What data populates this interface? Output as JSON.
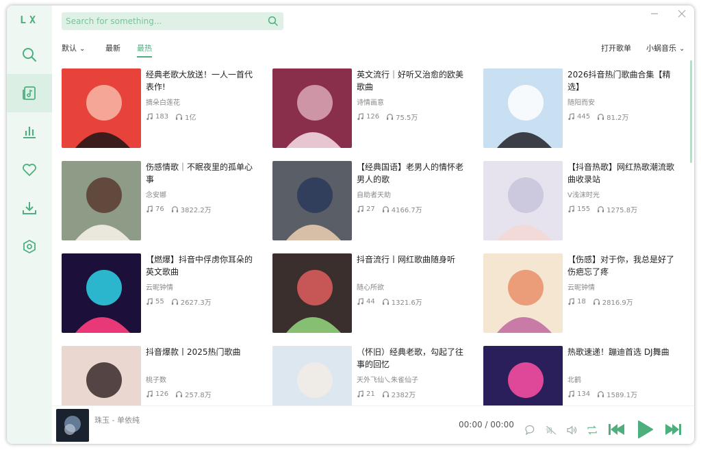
{
  "app": {
    "logo": "LX"
  },
  "search": {
    "placeholder": "Search for something..."
  },
  "filters": {
    "sort": "默认",
    "latest": "最新",
    "hottest": "最热"
  },
  "actions": {
    "open_playlist": "打开歌单",
    "source": "小蜗音乐"
  },
  "colors": {
    "accent": "#4caf7d",
    "sidebar_bg": "#eef7f2",
    "search_bg": "#dff0e6"
  },
  "sidebar_icons": [
    "search-icon",
    "music-list-icon",
    "chart-icon",
    "heart-icon",
    "download-icon",
    "settings-icon"
  ],
  "playlists": [
    {
      "title": "经典老歌大放送！一人一首代表作!",
      "author": "摘朵白莲花",
      "songs": "183",
      "plays": "1亿"
    },
    {
      "title": "英文流行｜好听又治愈的欧美歌曲",
      "author": "诗情画意",
      "songs": "126",
      "plays": "75.5万"
    },
    {
      "title": "2026抖音热门歌曲合集【精选】",
      "author": "随阳而安",
      "songs": "445",
      "plays": "81.2万"
    },
    {
      "title": "伤感情歌｜不眠夜里的孤单心事",
      "author": "念安娜",
      "songs": "76",
      "plays": "3822.2万"
    },
    {
      "title": "【经典国语】老男人的情怀老男人的歌",
      "author": "自助者天助",
      "songs": "27",
      "plays": "4166.7万"
    },
    {
      "title": "【抖音热歌】网红热歌潮流歌曲收录站",
      "author": "V浅沫时光",
      "songs": "155",
      "plays": "1275.8万"
    },
    {
      "title": "【燃爆】抖音中俘虏你耳朵的英文歌曲",
      "author": "云昵钟情",
      "songs": "55",
      "plays": "2627.3万"
    },
    {
      "title": "抖音流行丨网红歌曲随身听",
      "author": "随心所欲",
      "songs": "44",
      "plays": "1321.6万"
    },
    {
      "title": "【伤感】对于你，我总是好了伤疤忘了疼",
      "author": "云昵钟情",
      "songs": "18",
      "plays": "2816.9万"
    },
    {
      "title": "抖音爆款丨2025热门歌曲",
      "author": "桃子数",
      "songs": "126",
      "plays": "257.8万"
    },
    {
      "title": "（怀旧）经典老歌，勾起了往事的回忆",
      "author": "天外飞仙乀朱雀仙子",
      "songs": "21",
      "plays": "2382万"
    },
    {
      "title": "热歌速递！蹦迪首选 DJ舞曲",
      "author": "北鹤",
      "songs": "134",
      "plays": "1589.1万"
    }
  ],
  "player": {
    "now_playing": "珠玉 - 单依纯",
    "time": "00:00 / 00:00"
  }
}
